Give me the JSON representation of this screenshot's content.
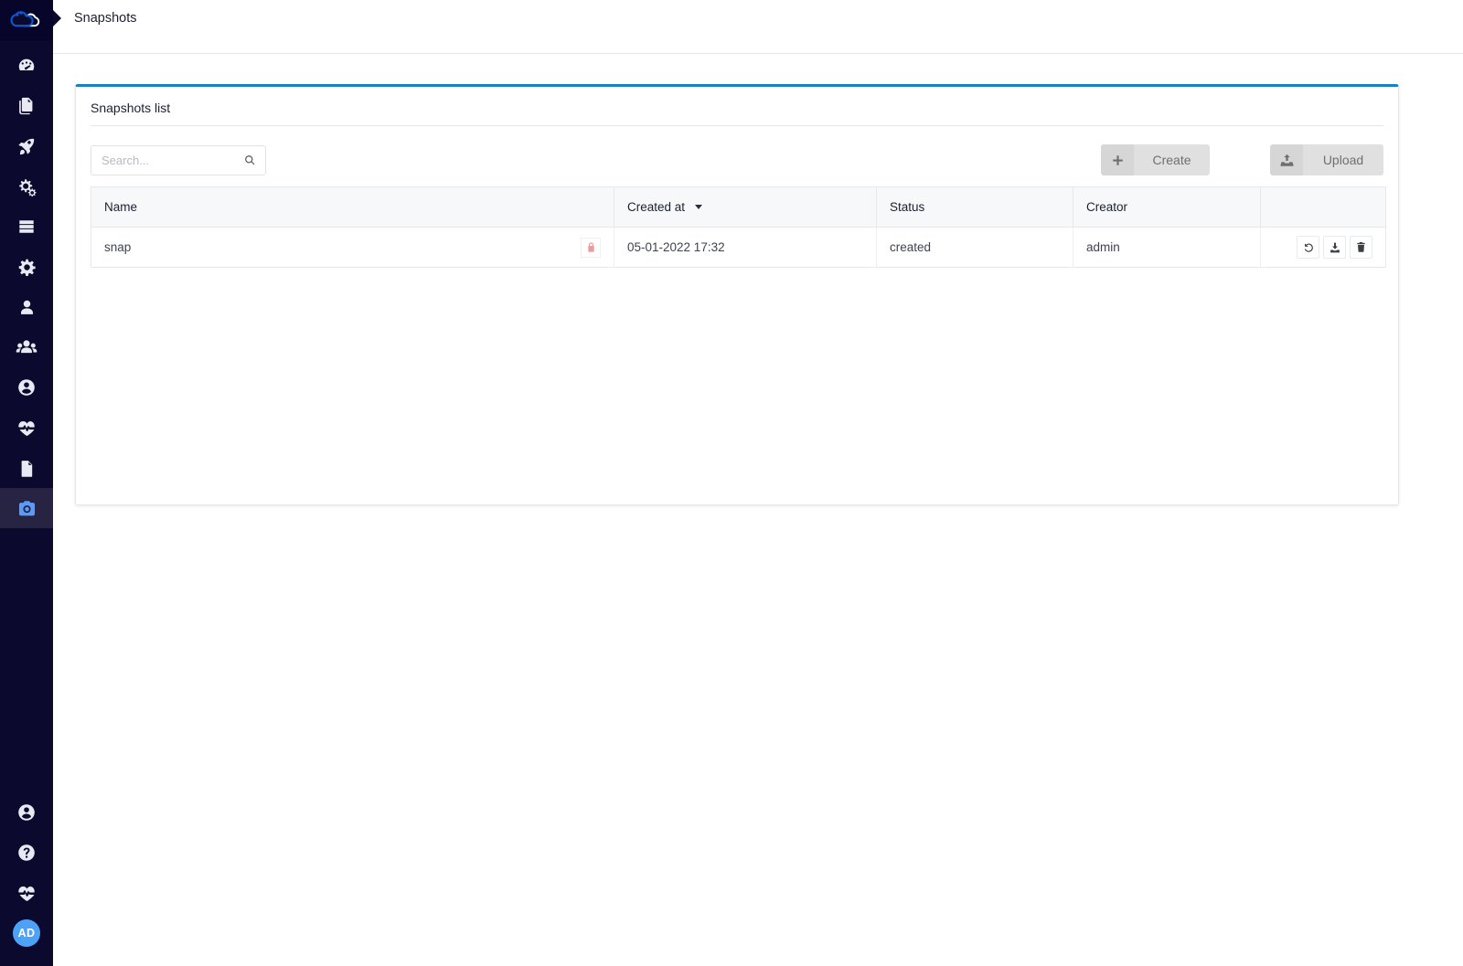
{
  "app": {
    "logo_icon": "cloud-logo-icon",
    "accent_color": "#1a7fc4",
    "sidebar_bg": "#0b0a2e",
    "active_icon_color": "#5b9bf8",
    "lock_color": "#eb9a9a"
  },
  "header": {
    "title": "Snapshots",
    "breadcrumb_arrow_icon": "caret-right-icon"
  },
  "sidebar": {
    "top_items": [
      {
        "icon": "dashboard-gauge-icon",
        "label": "Dashboard",
        "active": false
      },
      {
        "icon": "copy-files-icon",
        "label": "Files",
        "active": false
      },
      {
        "icon": "rocket-icon",
        "label": "Deploy",
        "active": false
      },
      {
        "icon": "gears-icon",
        "label": "Services",
        "active": false
      },
      {
        "icon": "server-rack-icon",
        "label": "Servers",
        "active": false
      },
      {
        "icon": "gear-icon",
        "label": "Settings",
        "active": false
      },
      {
        "icon": "user-icon",
        "label": "User",
        "active": false
      },
      {
        "icon": "users-group-icon",
        "label": "Users",
        "active": false
      },
      {
        "icon": "account-circle-icon",
        "label": "Account",
        "active": false
      },
      {
        "icon": "heartbeat-icon",
        "label": "Health",
        "active": false
      },
      {
        "icon": "document-icon",
        "label": "Logs",
        "active": false
      },
      {
        "icon": "camera-icon",
        "label": "Snapshots",
        "active": true
      }
    ],
    "bottom_items": [
      {
        "icon": "account-circle-icon",
        "label": "Profile",
        "active": false
      },
      {
        "icon": "question-circle-icon",
        "label": "Help",
        "active": false
      },
      {
        "icon": "heartbeat-icon",
        "label": "Status",
        "active": false
      }
    ],
    "avatar": {
      "initials": "AD",
      "color": "#4da2f7"
    }
  },
  "card": {
    "title": "Snapshots list"
  },
  "search": {
    "placeholder": "Search...",
    "value": "",
    "icon": "search-icon"
  },
  "toolbar": {
    "create_label": "Create",
    "create_icon": "plus-icon",
    "upload_label": "Upload",
    "upload_icon": "upload-icon"
  },
  "table": {
    "columns": [
      {
        "key": "name",
        "label": "Name"
      },
      {
        "key": "created_at",
        "label": "Created at",
        "sorted": true,
        "sort_dir": "desc"
      },
      {
        "key": "status",
        "label": "Status"
      },
      {
        "key": "creator",
        "label": "Creator"
      },
      {
        "key": "actions",
        "label": ""
      }
    ],
    "rows": [
      {
        "name": "snap",
        "locked": true,
        "lock_icon": "lock-icon",
        "created_at": "05-01-2022 17:32",
        "status": "created",
        "creator": "admin",
        "actions": [
          {
            "icon": "restore-icon",
            "label": "Restore"
          },
          {
            "icon": "download-icon",
            "label": "Download"
          },
          {
            "icon": "trash-icon",
            "label": "Delete"
          }
        ]
      }
    ]
  }
}
